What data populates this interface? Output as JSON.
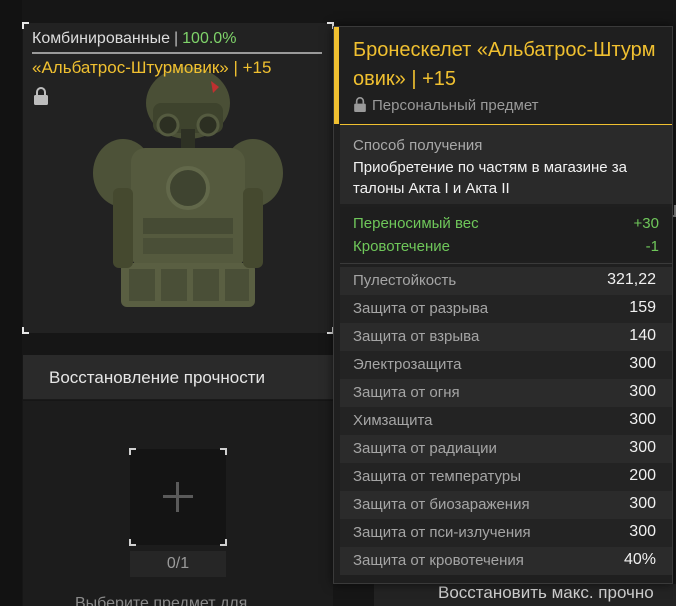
{
  "item_card": {
    "category": "Комбинированные",
    "separator": "|",
    "durability": "100.0%",
    "name": "«Альбатрос-Штурмовик» | +15"
  },
  "repair": {
    "title": "Восстановление прочности",
    "count": "0/1",
    "hint": "Выберите предмет для"
  },
  "bottom": {
    "restore_max": "Восстановить макс. прочно"
  },
  "tooltip": {
    "title": "Бронескелет «Альбатрос-Штурмовик» | +15",
    "personal": "Персональный предмет",
    "obtain_label": "Способ получения",
    "obtain_text": "Приобретение по частям в магазине за талоны Акта I и Акта II",
    "modifiers": [
      {
        "name": "Переносимый вес",
        "value": "+30"
      },
      {
        "name": "Кровотечение",
        "value": "-1"
      }
    ],
    "stats": [
      {
        "name": "Пулестойкость",
        "value": "321,22"
      },
      {
        "name": "Защита от разрыва",
        "value": "159"
      },
      {
        "name": "Защита от взрыва",
        "value": "140"
      },
      {
        "name": "Электрозащита",
        "value": "300"
      },
      {
        "name": "Защита от огня",
        "value": "300"
      },
      {
        "name": "Химзащита",
        "value": "300"
      },
      {
        "name": "Защита от радиации",
        "value": "300"
      },
      {
        "name": "Защита от температуры",
        "value": "200"
      },
      {
        "name": "Защита от биозаражения",
        "value": "300"
      },
      {
        "name": "Защита от пси-излучения",
        "value": "300"
      },
      {
        "name": "Защита от кровотечения",
        "value": "40%"
      }
    ]
  },
  "colors": {
    "accent": "#f0c030",
    "positive": "#6fc75a",
    "durability": "#7fd36a"
  },
  "icons": [
    "lock-icon",
    "plus-icon",
    "armor-image"
  ]
}
